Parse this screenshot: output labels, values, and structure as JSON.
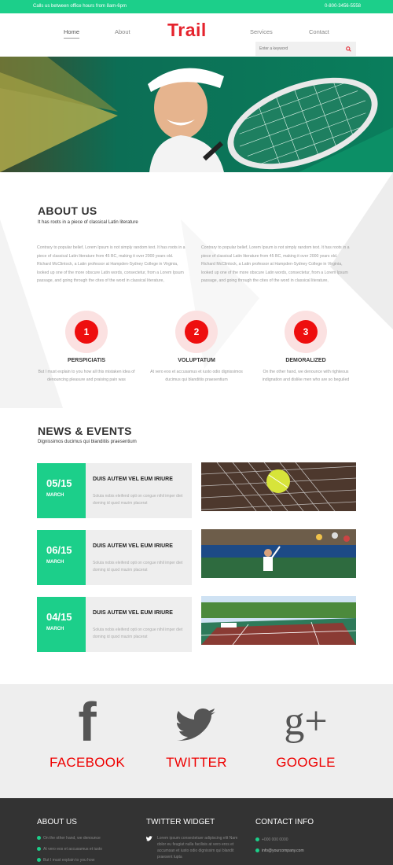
{
  "topbar": {
    "hours": "Calls us between office hours from 8am-6pm",
    "phone": "0-800-3456-5558"
  },
  "nav": {
    "items": [
      "Home",
      "About",
      "Services",
      "Contact"
    ],
    "logo": "Trail",
    "search_placeholder": "Enter a keyword"
  },
  "about": {
    "title": "ABOUT US",
    "subtitle": "It has roots in a piece of classical Latin literature",
    "paragraph": "Contrary to popular belief, Lorem Ipsum is not simply random text. It has roots in a piece of classical Latin literature from 45 BC, making it over 2000 years old. Richard McClintock, a Latin professor at Hampden-Sydney College in Virginia, looked up one of the more obscure Latin words, consectetur, from a Lorem Ipsum passage, and going through the cites of the word in classical literature,"
  },
  "features": [
    {
      "num": "1",
      "title": "PERSPICIATIS",
      "desc": "But I must explain to you how all this mistaken idea of denouncing pleasure and praising pain was"
    },
    {
      "num": "2",
      "title": "VOLUPTATUM",
      "desc": "At vero eos et accusamus et iusto odio dignissimos ducimus qui blanditiis praesentium"
    },
    {
      "num": "3",
      "title": "DEMORALIZED",
      "desc": "On the other hand, we denounce with righteous indignation and dislike men who are so beguiled"
    }
  ],
  "news": {
    "title": "NEWS & EVENTS",
    "subtitle": "Dignissimos ducimus qui blanditiis praesentium",
    "events": [
      {
        "day": "05/15",
        "month": "MARCH",
        "title": "DUIS AUTEM VEL EUM IRIURE",
        "desc": "Soluta nobis eleifend opti on congue nihil imper diet doming id quod mazim placerat"
      },
      {
        "day": "06/15",
        "month": "MARCH",
        "title": "DUIS AUTEM VEL EUM IRIURE",
        "desc": "Soluta nobis eleifend opti on congue nihil imper diet doming id quod mazim placerat"
      },
      {
        "day": "04/15",
        "month": "MARCH",
        "title": "DUIS AUTEM VEL EUM IRIURE",
        "desc": "Soluta nobis eleifend opti on congue nihil imper diet doming id quod mazim placerat"
      }
    ]
  },
  "social": {
    "facebook": "FACEBOOK",
    "twitter": "TWITTER",
    "google": "GOOGLE",
    "facebook_glyph": "f",
    "google_glyph": "g+"
  },
  "footer": {
    "about_title": "ABOUT US",
    "about_items": [
      "On the other hand, we denounce",
      "At vero eos et accusamus et iusto",
      "But I must explain to you how"
    ],
    "twitter_title": "TWITTER WIDGET",
    "twitter_text": "Lorem ipsum consectetuer adipiscing elit Nam dolor eu feugiat nulla facilisis at vero eros et accumsan et iusto odio dignissim qui blandit praesent lupta",
    "contact_title": "CONTACT INFO",
    "phone": "+000 000 0000",
    "email": "info@yourcompany.com"
  },
  "colors": {
    "accent": "#1ccf8a",
    "brand": "#e5232d"
  }
}
